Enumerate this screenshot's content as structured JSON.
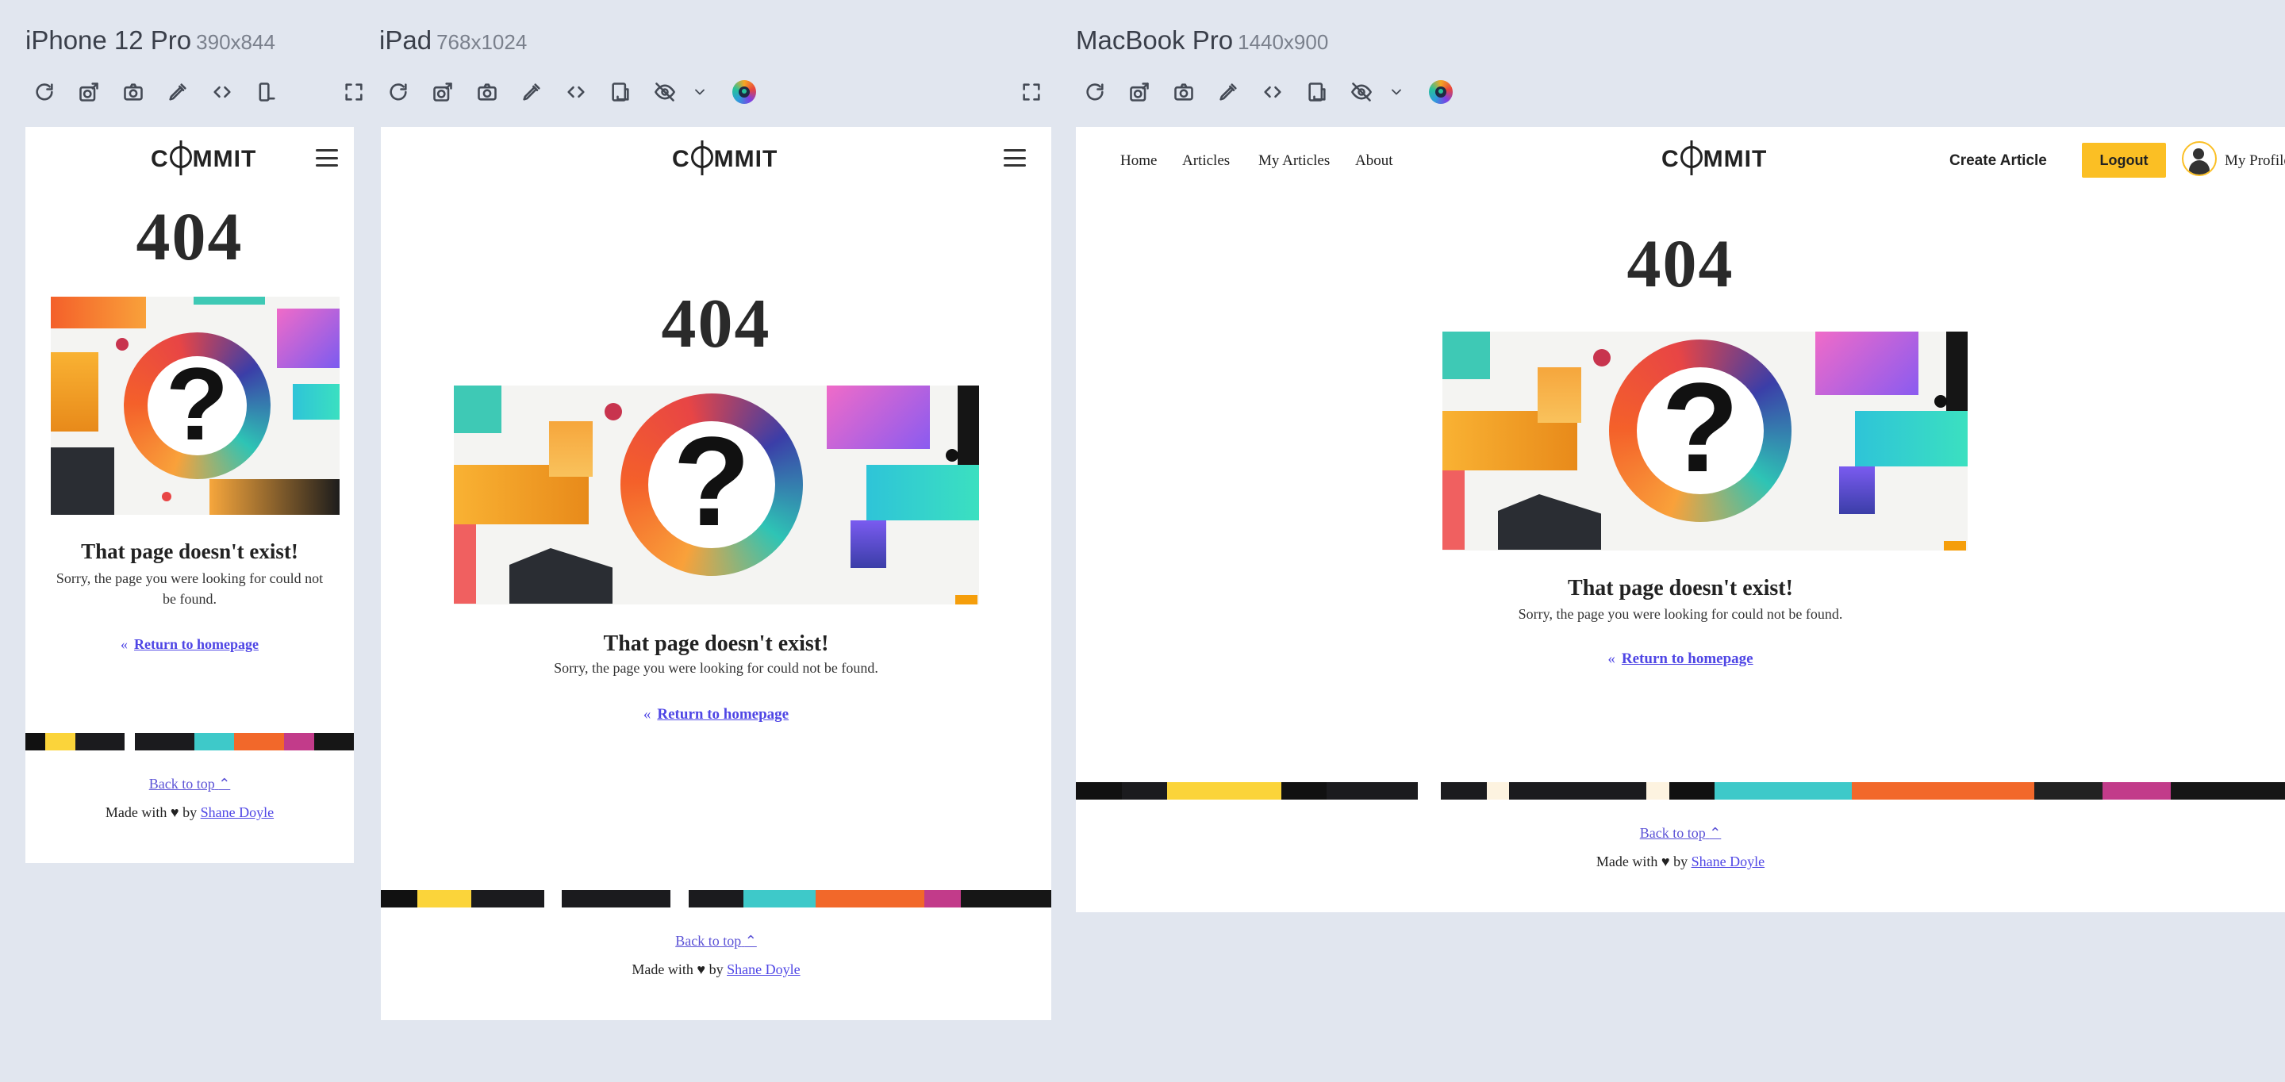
{
  "panes": {
    "iphone": {
      "title": "iPhone 12 Pro",
      "dims": "390x844"
    },
    "ipad": {
      "title": "iPad",
      "dims": "768x1024"
    },
    "macbook": {
      "title": "MacBook Pro",
      "dims": "1440x900"
    }
  },
  "toolbar_icons": [
    "reload-icon",
    "screenshot-full-icon",
    "camera-icon",
    "color-picker-icon",
    "code-icon",
    "rotate-device-icon",
    "emulation-hide-icon",
    "chevron-down-icon",
    "polypane-icon",
    "fullscreen-icon"
  ],
  "site": {
    "logo": {
      "pre": "C",
      "post": "MMIT"
    },
    "nav": [
      "Home",
      "Articles",
      "My Articles",
      "About"
    ],
    "create_article": "Create Article",
    "logout": "Logout",
    "profile": "My Profile",
    "code": "404",
    "heading": "That page doesn't exist!",
    "subtext": "Sorry, the page you were looking for could not be found.",
    "return_link": "Return to homepage",
    "back_to_top": "Back to top",
    "made_with": "Made with",
    "by": "by",
    "author": "Shane Doyle"
  },
  "colors": {
    "accent": "#4f46e5",
    "logout_bg": "#fbbf24",
    "canvas": "#e1e6ef"
  }
}
